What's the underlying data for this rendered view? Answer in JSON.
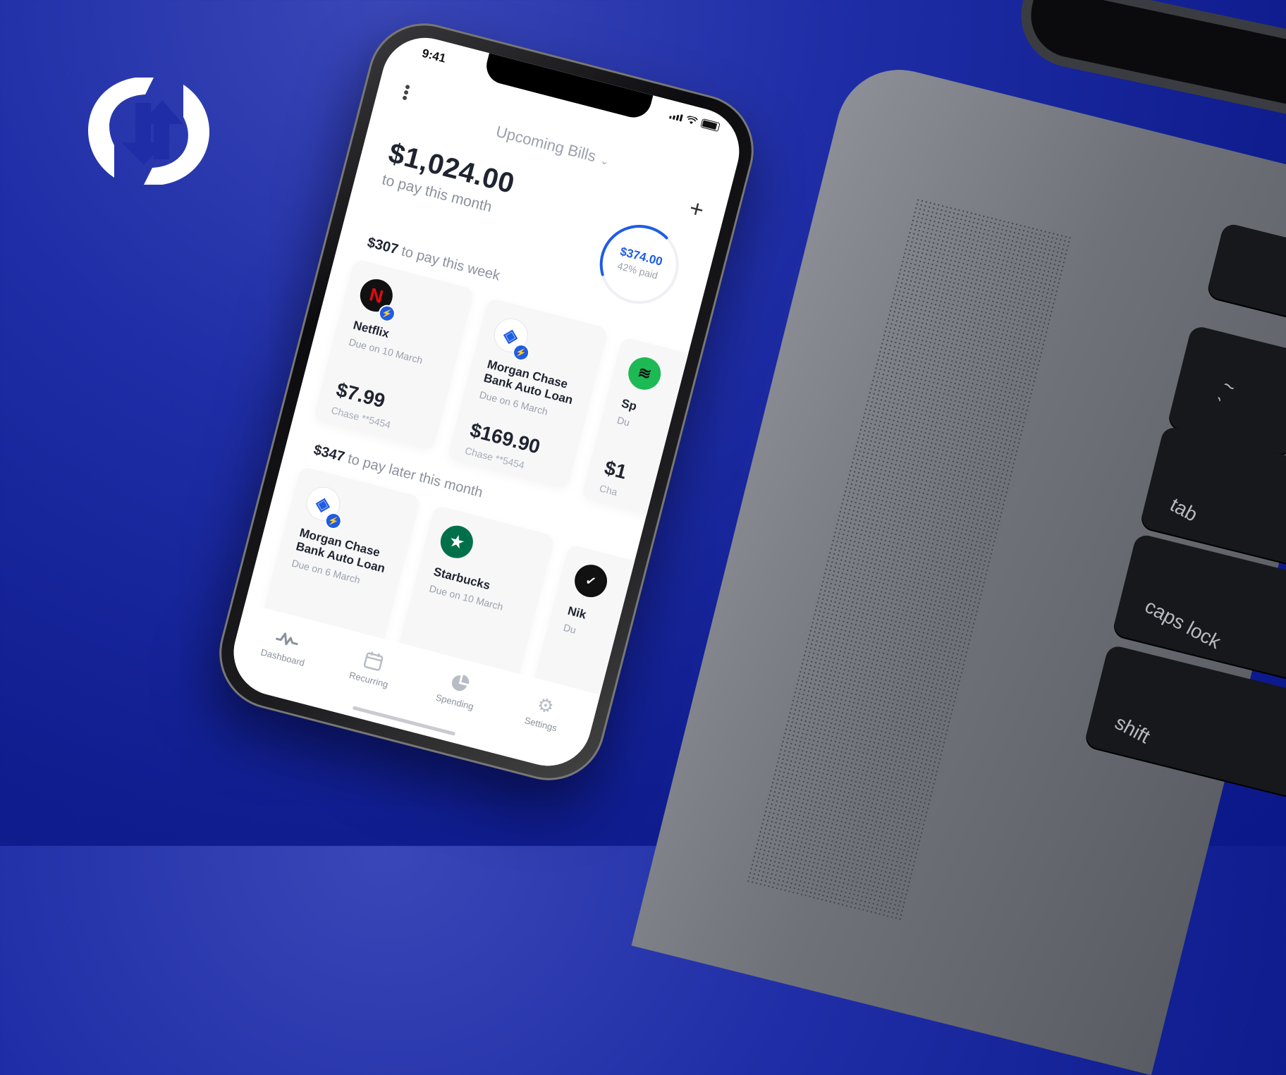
{
  "colors": {
    "background": "#1f2ea6",
    "accent": "#1f5ce6",
    "text_dark": "#1f2430",
    "text_muted": "#8b919c"
  },
  "brand": {
    "icon": "refresh-arrows-icon"
  },
  "phone": {
    "status_bar": {
      "time": "9:41"
    },
    "header": {
      "title": "Upcoming Bills",
      "menu_icon": "more-dots-icon",
      "add_icon": "plus-icon"
    },
    "summary": {
      "total": "$1,024.00",
      "total_caption": "to pay this month",
      "paid_amount": "$374.00",
      "paid_caption": "42% paid",
      "paid_fraction": 0.42
    },
    "week_section": {
      "amount": "$307",
      "caption": "to pay this week",
      "bills": [
        {
          "name": "Netflix",
          "due": "Due on 10 March",
          "amount": "$7.99",
          "account": "Chase **5454",
          "logo": "netflix-logo-icon",
          "autopay": true
        },
        {
          "name": "Morgan Chase Bank Auto Loan",
          "due": "Due on 6 March",
          "amount": "$169.90",
          "account": "Chase **5454",
          "logo": "chase-logo-icon",
          "autopay": true
        },
        {
          "name": "Sp",
          "due": "Du",
          "amount": "$1",
          "account": "Cha",
          "logo": "spotify-logo-icon",
          "autopay": false
        }
      ]
    },
    "later_section": {
      "amount": "$347",
      "caption": "to pay later this month",
      "bills": [
        {
          "name": "Morgan Chase Bank Auto Loan",
          "due": "Due on 6 March",
          "logo": "chase-logo-icon",
          "autopay": true
        },
        {
          "name": "Starbucks",
          "due": "Due on 10 March",
          "logo": "starbucks-logo-icon",
          "autopay": false
        },
        {
          "name": "Nik",
          "due": "Du",
          "logo": "nike-logo-icon",
          "autopay": false
        }
      ]
    },
    "tabs": [
      {
        "label": "Dashboard",
        "icon": "activity-icon"
      },
      {
        "label": "Recurring",
        "icon": "calendar-icon"
      },
      {
        "label": "Spending",
        "icon": "pie-chart-icon"
      },
      {
        "label": "Settings",
        "icon": "gear-icon"
      }
    ]
  },
  "laptop_keys": [
    {
      "label": "~\n`"
    },
    {
      "label": "tab"
    },
    {
      "label": "caps lock"
    },
    {
      "label": "shift"
    }
  ]
}
